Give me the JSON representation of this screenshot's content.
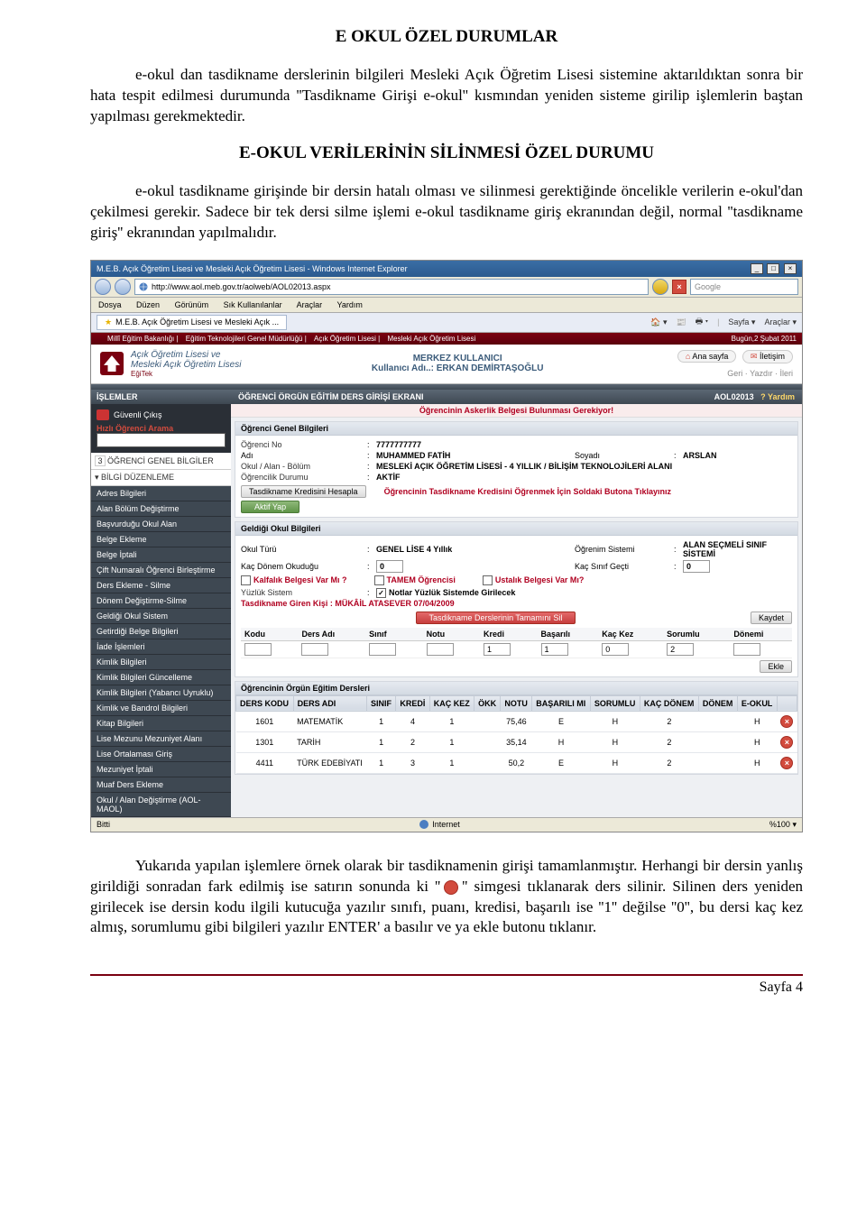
{
  "doc": {
    "title1": "E OKUL ÖZEL DURUMLAR",
    "para1": "e-okul dan tasdikname derslerinin bilgileri Mesleki Açık Öğretim Lisesi sistemine aktarıldıktan sonra bir hata tespit edilmesi durumunda ''Tasdikname Girişi e-okul'' kısmından yeniden sisteme girilip işlemlerin baştan yapılması gerekmektedir.",
    "title2": "E-OKUL VERİLERİNİN SİLİNMESİ ÖZEL DURUMU",
    "para2": "e-okul tasdikname girişinde bir dersin hatalı olması ve silinmesi gerektiğinde öncelikle verilerin e-okul'dan çekilmesi gerekir. Sadece bir tek dersi silme işlemi e-okul tasdikname giriş ekranından değil, normal ''tasdikname giriş'' ekranından yapılmalıdır.",
    "para3a": "Yukarıda yapılan işlemlere örnek olarak bir tasdiknamenin girişi tamamlanmıştır. Herhangi bir dersin yanlış girildiği sonradan fark edilmiş ise satırın sonunda ki ''",
    "para3b": "'' simgesi tıklanarak ders silinir. Silinen ders yeniden girilecek ise dersin kodu ilgili kutucuğa yazılır sınıfı, puanı, kredisi, başarılı ise ''1'' değilse ''0'', bu dersi kaç kez almış, sorumlumu gibi bilgileri yazılır ENTER' a basılır ve ya ekle butonu tıklanır.",
    "footer": "Sayfa 4"
  },
  "ie": {
    "title": "M.E.B. Açık Öğretim Lisesi ve Mesleki Açık Öğretim Lisesi - Windows Internet Explorer",
    "url": "http://www.aol.meb.gov.tr/aolweb/AOL02013.aspx",
    "search_placeholder": "Google",
    "menu": [
      "Dosya",
      "Düzen",
      "Görünüm",
      "Sık Kullanılanlar",
      "Araçlar",
      "Yardım"
    ],
    "tab": "M.E.B. Açık Öğretim Lisesi ve Mesleki Açık ...",
    "toolbar2": {
      "sayfa": "Sayfa",
      "araclar": "Araçlar"
    },
    "status_left": "Bitti",
    "status_mid": "Internet",
    "status_zoom": "%100"
  },
  "crumbs": {
    "left": [
      "Millî Eğitim Bakanlığı",
      "Eğitim Teknolojileri Genel Müdürlüğü",
      "Açık Öğretim Lisesi",
      "Mesleki Açık Öğretim Lisesi"
    ],
    "right": "Bugün,2 Şubat 2011"
  },
  "header": {
    "brand1": "Açık Öğretim Lisesi ve",
    "brand2": "Mesleki Açık Öğretim Lisesi",
    "brand_sub": "EğiTek",
    "center1": "MERKEZ KULLANICI",
    "center2": "Kullanıcı Adı..: ERKAN DEMİRTAŞOĞLU",
    "ana_sayfa": "Ana sayfa",
    "iletisim": "İletişim",
    "bread": "Geri · Yazdır · İleri"
  },
  "sidebar": {
    "hdr": "İŞLEMLER",
    "guvenli": "Güvenli Çıkış",
    "hizli": "Hızlı Öğrenci Arama",
    "grp1_num": "3",
    "grp1": "ÖĞRENCİ GENEL BİLGİLER",
    "grp2": "BİLGİ DÜZENLEME",
    "items": [
      "Adres Bilgileri",
      "Alan Bölüm Değiştirme",
      "Başvurduğu Okul Alan",
      "Belge Ekleme",
      "Belge İptali",
      "Çift Numaralı Öğrenci Birleştirme",
      "Ders Ekleme - Silme",
      "Dönem Değiştirme-Silme",
      "Geldiği Okul Sistem",
      "Getirdiği Belge Bilgileri",
      "İade İşlemleri",
      "Kimlik Bilgileri",
      "Kimlik Bilgileri Güncelleme",
      "Kimlik Bilgileri (Yabancı Uyruklu)",
      "Kimlik ve Bandrol Bilgileri",
      "Kitap Bilgileri",
      "Lise Mezunu Mezuniyet Alanı",
      "Lise Ortalaması Giriş",
      "Mezuniyet İptali",
      "Muaf Ders Ekleme",
      "Okul / Alan Değiştirme (AOL-MAOL)"
    ]
  },
  "content": {
    "hdr": "ÖĞRENCİ ÖRGÜN EĞİTİM DERS GİRİŞİ EKRANI",
    "code": "AOL02013",
    "yardim": "Yardım",
    "alert": "Öğrencinin Askerlik Belgesi Bulunması Gerekiyor!",
    "panel1_hdr": "Öğrenci Genel Bilgileri",
    "ogrno_k": "Öğrenci No",
    "ogrno_v": "7777777777",
    "adi_k": "Adı",
    "adi_v": "MUHAMMED FATİH",
    "soyadi_k": "Soyadı",
    "soyadi_v": "ARSLAN",
    "okul_k": "Okul / Alan - Bölüm",
    "okul_v": "MESLEKİ AÇIK ÖĞRETİM LİSESİ - 4 YILLIK / BİLİŞİM TEKNOLOJİLERİ ALANI",
    "durum_k": "Öğrencilik Durumu",
    "durum_v": "AKTİF",
    "kredi_btn": "Tasdikname Kredisini Hesapla",
    "kredi_note": "Öğrencinin Tasdikname Kredisini Öğrenmek İçin Soldaki Butona Tıklayınız",
    "aktif_btn": "Aktif Yap",
    "panel2_hdr": "Geldiği Okul Bilgileri",
    "okulturu_k": "Okul Türü",
    "okulturu_v": "GENEL LİSE 4 Yıllık",
    "ogrsis_k": "Öğrenim Sistemi",
    "ogrsis_v": "ALAN SEÇMELİ SINIF SİSTEMİ",
    "kacdonem_k": "Kaç Dönem Okuduğu",
    "kacdonem_v": "0",
    "kacsinif_k": "Kaç Sınıf Geçti",
    "kacsinif_v": "0",
    "kalfalik": "Kalfalık Belgesi Var Mı ?",
    "tamem": "TAMEM Öğrencisi",
    "ustalik": "Ustalık Belgesi Var Mı?",
    "yuzluk_k": "Yüzlük Sistem",
    "yuzluk_v": "Notlar Yüzlük Sistemde Girilecek",
    "giren": "Tasdikname Giren Kişi : MÜKÂİL ATASEVER 07/04/2009",
    "silbtn": "Tasdikname Derslerinin Tamamını Sil",
    "kaydet": "Kaydet",
    "ekle": "Ekle",
    "mini_headers": [
      "Kodu",
      "Ders Adı",
      "Sınıf",
      "Notu",
      "Kredi",
      "Başarılı",
      "Kaç Kez",
      "Sorumlu",
      "Dönemi"
    ],
    "mini_row": [
      "",
      "",
      "",
      "",
      "1",
      "1",
      "0",
      "2",
      ""
    ],
    "panel3_hdr": "Öğrencinin Örgün Eğitim Dersleri",
    "table_headers": [
      "DERS KODU",
      "DERS ADI",
      "SINIF",
      "KREDİ",
      "KAÇ KEZ",
      "ÖKK",
      "NOTU",
      "BAŞARILI MI",
      "SORUMLU",
      "KAÇ DÖNEM",
      "DÖNEM",
      "E-OKUL",
      ""
    ],
    "rows": [
      {
        "c": [
          "1601",
          "MATEMATİK",
          "1",
          "4",
          "1",
          "",
          "75,46",
          "E",
          "H",
          "2",
          "",
          "H"
        ]
      },
      {
        "c": [
          "1301",
          "TARİH",
          "1",
          "2",
          "1",
          "",
          "35,14",
          "H",
          "H",
          "2",
          "",
          "H"
        ]
      },
      {
        "c": [
          "4411",
          "TÜRK EDEBİYATI",
          "1",
          "3",
          "1",
          "",
          "50,2",
          "E",
          "H",
          "2",
          "",
          "H"
        ]
      }
    ]
  }
}
